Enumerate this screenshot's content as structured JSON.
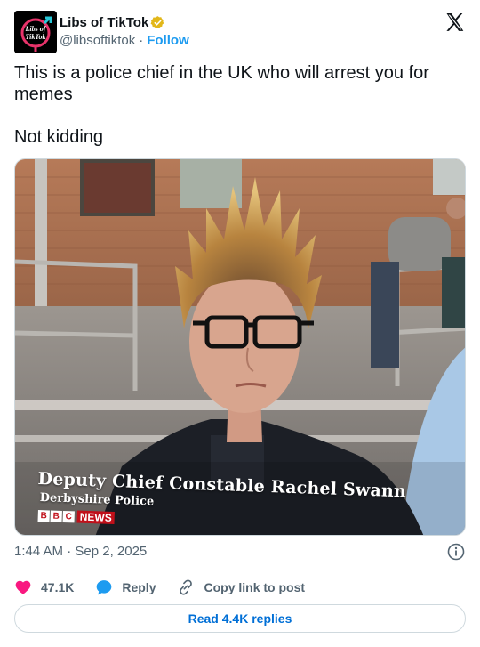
{
  "author": {
    "display_name": "Libs of TikTok",
    "handle": "@libsoftiktok",
    "follow_label": "Follow",
    "separator": "·",
    "verified": true,
    "badge_color": "#e2b719",
    "avatar_text": "Libs of TikTok"
  },
  "platform_icon": "x-logo-icon",
  "tweet": {
    "text_line1": "This is a police chief in the UK who will arrest you for memes",
    "text_line2": "Not kidding"
  },
  "media": {
    "caption_title": "Deputy Chief Constable Rachel Swann",
    "caption_subtitle": "Derbyshire Police",
    "broadcaster_letters": [
      "B",
      "B",
      "C"
    ],
    "broadcaster_label": "NEWS"
  },
  "meta": {
    "timestamp": "1:44 AM · Sep 2, 2025"
  },
  "actions": {
    "like_count": "47.1K",
    "reply_label": "Reply",
    "copy_label": "Copy link to post"
  },
  "read_replies_label": "Read 4.4K replies",
  "colors": {
    "like": "#f91880",
    "reply": "#1d9bf0",
    "link": "#006fd6"
  }
}
